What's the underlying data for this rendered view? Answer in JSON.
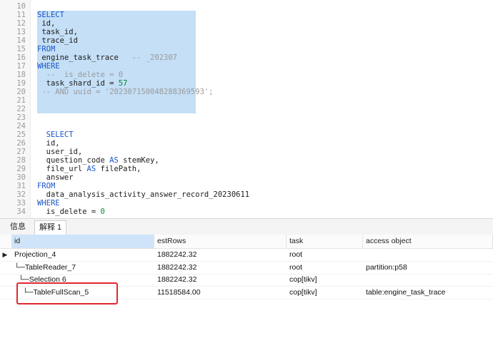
{
  "editor": {
    "lines": [
      {
        "n": "10",
        "parts": []
      },
      {
        "n": "11",
        "parts": [
          {
            "t": "SELECT",
            "c": "kw"
          }
        ]
      },
      {
        "n": "12",
        "parts": [
          {
            "t": " id,",
            "c": "id"
          }
        ]
      },
      {
        "n": "13",
        "parts": [
          {
            "t": " task_id,",
            "c": "id"
          }
        ]
      },
      {
        "n": "14",
        "parts": [
          {
            "t": " trace_id",
            "c": "id"
          }
        ]
      },
      {
        "n": "15",
        "parts": [
          {
            "t": "FROM",
            "c": "kw"
          }
        ]
      },
      {
        "n": "16",
        "parts": [
          {
            "t": " engine_task_trace   ",
            "c": "id"
          },
          {
            "t": "-- _202307",
            "c": "cm"
          }
        ]
      },
      {
        "n": "17",
        "parts": [
          {
            "t": "WHERE",
            "c": "kw"
          }
        ]
      },
      {
        "n": "18",
        "parts": [
          {
            "t": "  --  is_delete = 0",
            "c": "cm"
          }
        ]
      },
      {
        "n": "19",
        "parts": [
          {
            "t": "  task_shard_id = ",
            "c": "id"
          },
          {
            "t": "57",
            "c": "num"
          }
        ]
      },
      {
        "n": "20",
        "parts": [
          {
            "t": " -- AND uuid = '202307150048288369593';",
            "c": "cm"
          }
        ]
      },
      {
        "n": "21",
        "parts": []
      },
      {
        "n": "22",
        "parts": []
      },
      {
        "n": "23",
        "parts": []
      },
      {
        "n": "24",
        "parts": []
      },
      {
        "n": "25",
        "parts": [
          {
            "t": "  SELECT",
            "c": "kw"
          }
        ]
      },
      {
        "n": "26",
        "parts": [
          {
            "t": "  id,",
            "c": "id"
          }
        ]
      },
      {
        "n": "27",
        "parts": [
          {
            "t": "  user_id,",
            "c": "id"
          }
        ]
      },
      {
        "n": "28",
        "parts": [
          {
            "t": "  question_code ",
            "c": "id"
          },
          {
            "t": "AS",
            "c": "kw"
          },
          {
            "t": " stemKey,",
            "c": "id"
          }
        ]
      },
      {
        "n": "29",
        "parts": [
          {
            "t": "  file_url ",
            "c": "id"
          },
          {
            "t": "AS",
            "c": "kw"
          },
          {
            "t": " filePath,",
            "c": "id"
          }
        ]
      },
      {
        "n": "30",
        "parts": [
          {
            "t": "  answer",
            "c": "id"
          }
        ]
      },
      {
        "n": "31",
        "parts": [
          {
            "t": "FROM",
            "c": "kw"
          }
        ]
      },
      {
        "n": "32",
        "parts": [
          {
            "t": "  data_analysis_activity_answer_record_20230611",
            "c": "id"
          }
        ]
      },
      {
        "n": "33",
        "parts": [
          {
            "t": "WHERE",
            "c": "kw"
          }
        ]
      },
      {
        "n": "34",
        "parts": [
          {
            "t": "  is_delete = ",
            "c": "id"
          },
          {
            "t": "0",
            "c": "num"
          }
        ]
      }
    ]
  },
  "tabs": {
    "info": "信息",
    "explain": "解释 1"
  },
  "grid": {
    "columns": [
      "id",
      "estRows",
      "task",
      "access object"
    ],
    "rows": [
      {
        "id": "Projection_4",
        "est": "1882242.32",
        "task": "root",
        "acc": "",
        "marker": "▶"
      },
      {
        "id": "└─TableReader_7",
        "est": "1882242.32",
        "task": "root",
        "acc": "partition:p58",
        "marker": ""
      },
      {
        "id": "  └─Selection 6",
        "est": "1882242.32",
        "task": "cop[tikv]",
        "acc": "",
        "marker": ""
      },
      {
        "id": "    └─TableFullScan_5",
        "est": "11518584.00",
        "task": "cop[tikv]",
        "acc": "table:engine_task_trace",
        "marker": ""
      }
    ]
  },
  "colors": {
    "selection": "#c4dff6",
    "keyword": "#1a55c9",
    "comment": "#9a9a9a",
    "number": "#0a8a2e",
    "highlight_box": "#e0282f"
  }
}
